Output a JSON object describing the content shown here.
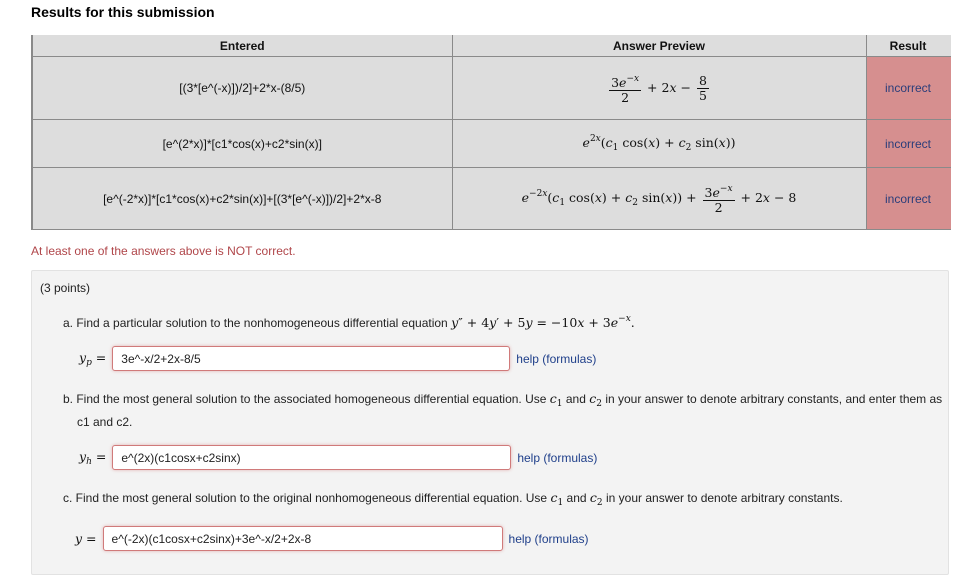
{
  "page": {
    "title": "Results for this submission"
  },
  "results_table": {
    "headers": [
      "Entered",
      "Answer Preview",
      "Result"
    ],
    "rows": [
      {
        "entered": "[(3*[e^(-x)])/2]+2*x-(8/5)",
        "preview": "3e^{-x}/2 + 2x - 8/5",
        "result": "incorrect"
      },
      {
        "entered": "[e^(2*x)]*[c1*cos(x)+c2*sin(x)]",
        "preview": "e^{2x}(c_1 cos(x) + c_2 sin(x))",
        "result": "incorrect"
      },
      {
        "entered": "[e^(-2*x)]*[c1*cos(x)+c2*sin(x)]+[(3*[e^(-x)])/2]+2*x-8",
        "preview": "e^{-2x}(c_1 cos(x) + c_2 sin(x)) + 3e^{-x}/2 + 2x - 8",
        "result": "incorrect"
      }
    ],
    "result_color": "#d68f8f"
  },
  "warning": "At least one of the answers above is NOT correct.",
  "problem": {
    "points": "(3 points)",
    "part_a": {
      "text": "a. Find a particular solution to the nonhomogeneous differential equation",
      "equation": "y″ + 4y′ + 5y = −10x + 3e^{−x}.",
      "label": "y_p =",
      "value": "3e^-x/2+2x-8/5",
      "help": "help (formulas)"
    },
    "part_b": {
      "text_1": "b. Find the most general solution to the associated homogeneous differential equation. Use",
      "text_2": "and",
      "text_3": "in your answer to denote arbitrary constants, and enter them as c1 and c2.",
      "label": "y_h =",
      "value": "e^(2x)(c1cosx+c2sinx)",
      "help": "help (formulas)"
    },
    "part_c": {
      "text_1": "c. Find the most general solution to the original nonhomogeneous differential equation. Use",
      "text_2": "and",
      "text_3": "in your answer to denote arbitrary constants.",
      "label": "y =",
      "value": "e^(-2x)(c1cosx+c2sinx)+3e^-x/2+2x-8",
      "help": "help (formulas)"
    }
  }
}
